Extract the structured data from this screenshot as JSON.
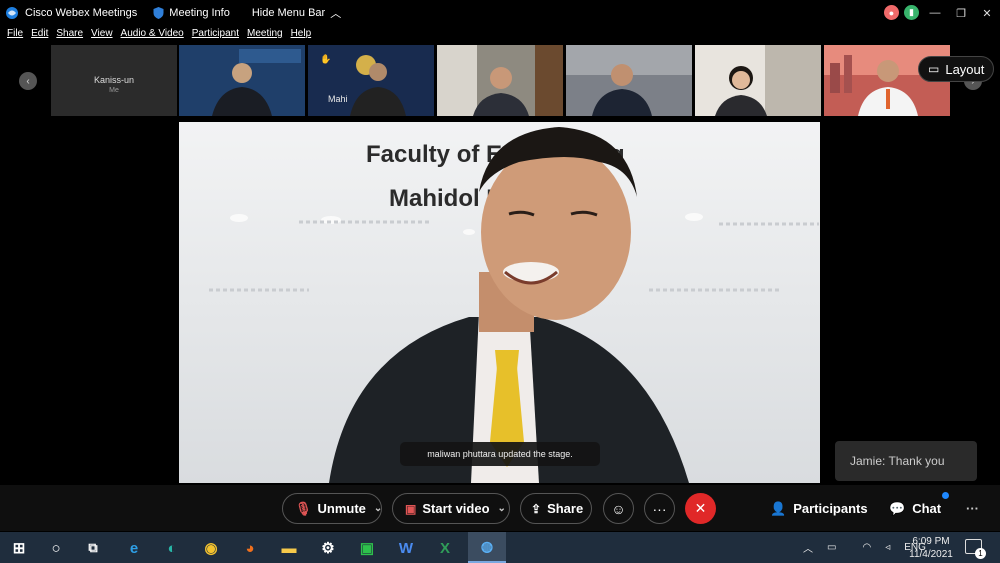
{
  "window": {
    "app_title": "Cisco Webex Meetings",
    "meeting_info": "Meeting Info",
    "hide_menu_bar": "Hide Menu Bar"
  },
  "status": {
    "recording_icon": "record-icon",
    "network_icon": "signal-icon"
  },
  "menu": [
    "File",
    "Edit",
    "Share",
    "View",
    "Audio & Video",
    "Participant",
    "Meeting",
    "Help"
  ],
  "filmstrip": {
    "self": {
      "name": "Kaniss-un",
      "sub": "Me"
    },
    "layout_label": "Layout"
  },
  "stage": {
    "wall_text_1": "Faculty of Engineering",
    "wall_text_2": "Mahidol University",
    "toast": "maliwan phuttara updated the stage."
  },
  "chat_preview": "Jamie: Thank you",
  "controls": {
    "unmute": "Unmute",
    "start_video": "Start video",
    "share": "Share",
    "participants": "Participants",
    "chat": "Chat"
  },
  "taskbar": {
    "language": "ENG",
    "time": "6:09 PM",
    "date": "11/4/2021",
    "notifications": "1"
  },
  "colors": {
    "end_call": "#e02828",
    "accent": "#0f6fde",
    "taskbar": "#1f2d3d"
  }
}
